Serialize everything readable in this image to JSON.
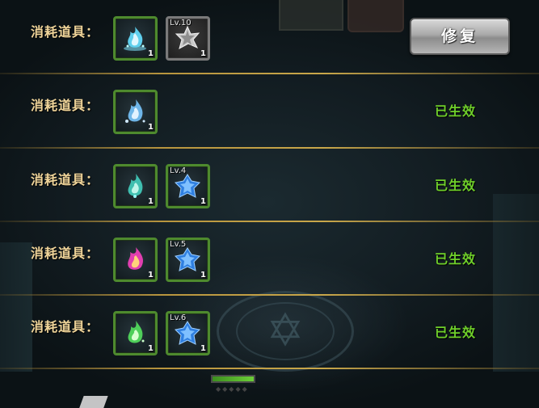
{
  "rows": [
    {
      "label": "消耗道具：",
      "items": [
        {
          "icon": "cyan-spirit-flame-icon",
          "lv": "",
          "qty": "1",
          "border": "green"
        },
        {
          "icon": "silver-star-crystal-icon",
          "lv": "Lv.10",
          "qty": "1",
          "border": "gray"
        }
      ],
      "action": "修复"
    },
    {
      "label": "消耗道具：",
      "items": [
        {
          "icon": "blue-spirit-flame-icon",
          "lv": "",
          "qty": "1",
          "border": "green"
        }
      ],
      "status": "已生效"
    },
    {
      "label": "消耗道具：",
      "items": [
        {
          "icon": "teal-spirit-flame-icon",
          "lv": "",
          "qty": "1",
          "border": "green"
        },
        {
          "icon": "blue-star-crystal-icon",
          "lv": "Lv.4",
          "qty": "1",
          "border": "green"
        }
      ],
      "status": "已生效"
    },
    {
      "label": "消耗道具：",
      "items": [
        {
          "icon": "pink-spirit-flame-icon",
          "lv": "",
          "qty": "1",
          "border": "green"
        },
        {
          "icon": "blue-star-crystal-icon",
          "lv": "Lv.5",
          "qty": "1",
          "border": "green"
        }
      ],
      "status": "已生效"
    },
    {
      "label": "消耗道具：",
      "items": [
        {
          "icon": "green-spirit-flame-icon",
          "lv": "",
          "qty": "1",
          "border": "green"
        },
        {
          "icon": "blue-star-crystal-icon",
          "lv": "Lv.6",
          "qty": "1",
          "border": "green"
        }
      ],
      "status": "已生效"
    }
  ],
  "colors": {
    "label": "#f0d59a",
    "status_active": "#6fcf2a",
    "slot_border_green": "#4e8a2e",
    "divider_gold": "#c9a74a"
  }
}
